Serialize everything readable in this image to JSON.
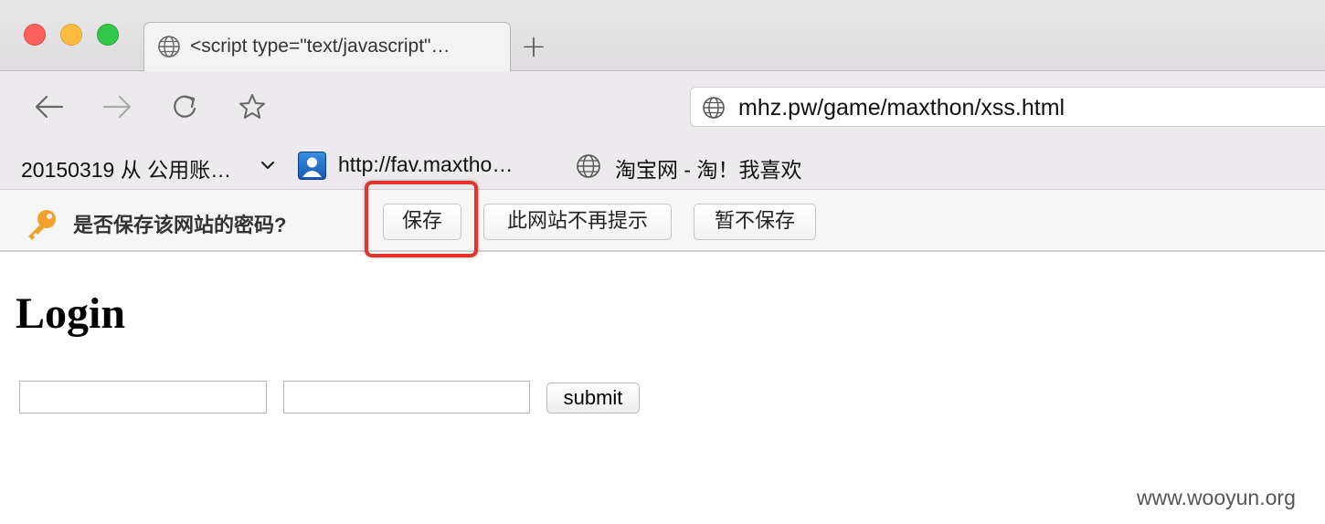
{
  "tab": {
    "title": "<script type=\"text/javascript\"…",
    "new_tab_label": "+"
  },
  "toolbar": {
    "address_url": "mhz.pw/game/maxthon/xss.html"
  },
  "bookmarks": {
    "items": [
      {
        "label": "20150319 从 公用账…",
        "icon": "chevron-down-icon"
      },
      {
        "label": "http://fav.maxtho…",
        "icon": "maxthon-user-icon"
      },
      {
        "label": "淘宝网 - 淘！我喜欢",
        "icon": "globe-icon"
      }
    ]
  },
  "password_bar": {
    "prompt": "是否保存该网站的密码?",
    "save_label": "保存",
    "never_label": "此网站不再提示",
    "not_now_label": "暂不保存",
    "highlight_color": "#e3342b"
  },
  "page": {
    "heading": "Login",
    "submit_label": "submit"
  },
  "watermark": "www.wooyun.org",
  "colors": {
    "traffic_close": "#fc605c",
    "traffic_minimize": "#fdbc40",
    "traffic_maximize": "#34c84a",
    "key_icon": "#f2a12d"
  }
}
